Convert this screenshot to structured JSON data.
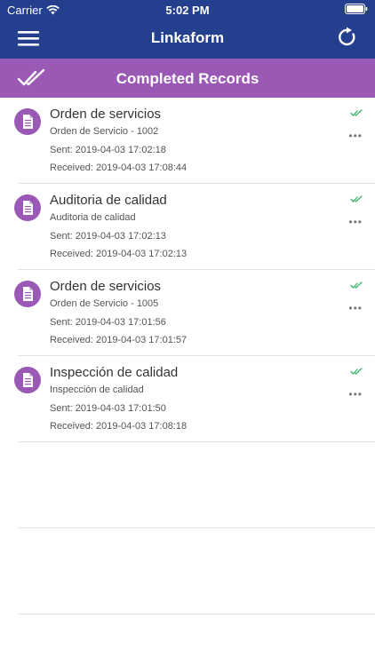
{
  "status_bar": {
    "carrier": "Carrier",
    "time": "5:02 PM"
  },
  "nav": {
    "title": "Linkaform",
    "left_icon": "hamburger-menu-icon",
    "right_icon": "refresh-icon"
  },
  "section": {
    "title": "Completed Records",
    "icon": "double-check-icon"
  },
  "colors": {
    "nav_background": "#253f8f",
    "section_background": "#9b59b6",
    "avatar_background": "#9b59b6",
    "check_green": "#3bb26a"
  },
  "records": [
    {
      "title": "Orden de servicios",
      "subtitle": "Orden de Servicio - 1002",
      "sent": "Sent: 2019-04-03 17:02:18",
      "received": "Received: 2019-04-03 17:08:44",
      "more": "•••"
    },
    {
      "title": "Auditoria de calidad",
      "subtitle": "Auditoria de calidad",
      "sent": "Sent: 2019-04-03 17:02:13",
      "received": "Received: 2019-04-03 17:02:13",
      "more": "•••"
    },
    {
      "title": "Orden de servicios",
      "subtitle": "Orden de Servicio - 1005",
      "sent": "Sent: 2019-04-03 17:01:56",
      "received": "Received: 2019-04-03 17:01:57",
      "more": "•••"
    },
    {
      "title": "Inspección de calidad",
      "subtitle": "Inspección de calidad",
      "sent": "Sent: 2019-04-03 17:01:50",
      "received": "Received: 2019-04-03 17:08:18",
      "more": "•••"
    }
  ]
}
